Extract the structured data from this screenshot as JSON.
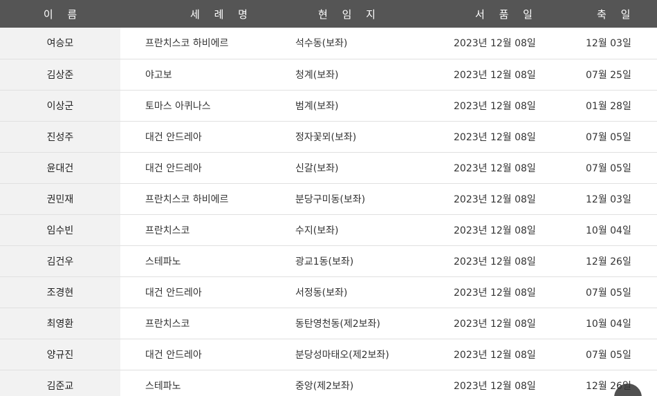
{
  "table": {
    "headers": {
      "name": "이 름",
      "saint_name": "세 례 명",
      "parish": "현 임 지",
      "ordination": "서 품 일",
      "feast_day": "축 일"
    },
    "rows": [
      {
        "name": "여승모",
        "saint_name": "프란치스코 하비에르",
        "parish": "석수동(보좌)",
        "ordination": "2023년 12월 08일",
        "feast_day": "12월 03일"
      },
      {
        "name": "김상준",
        "saint_name": "야고보",
        "parish": "청계(보좌)",
        "ordination": "2023년 12월 08일",
        "feast_day": "07월 25일"
      },
      {
        "name": "이상군",
        "saint_name": "토마스 아퀴나스",
        "parish": "범계(보좌)",
        "ordination": "2023년 12월 08일",
        "feast_day": "01월 28일"
      },
      {
        "name": "진성주",
        "saint_name": "대건 안드레아",
        "parish": "정자꽃뫼(보좌)",
        "ordination": "2023년 12월 08일",
        "feast_day": "07월 05일"
      },
      {
        "name": "윤대건",
        "saint_name": "대건 안드레아",
        "parish": "신갈(보좌)",
        "ordination": "2023년 12월 08일",
        "feast_day": "07월 05일"
      },
      {
        "name": "권민재",
        "saint_name": "프란치스코 하비에르",
        "parish": "분당구미동(보좌)",
        "ordination": "2023년 12월 08일",
        "feast_day": "12월 03일"
      },
      {
        "name": "임수빈",
        "saint_name": "프란치스코",
        "parish": "수지(보좌)",
        "ordination": "2023년 12월 08일",
        "feast_day": "10월 04일"
      },
      {
        "name": "김건우",
        "saint_name": "스테파노",
        "parish": "광교1동(보좌)",
        "ordination": "2023년 12월 08일",
        "feast_day": "12월 26일"
      },
      {
        "name": "조경현",
        "saint_name": "대건 안드레아",
        "parish": "서정동(보좌)",
        "ordination": "2023년 12월 08일",
        "feast_day": "07월 05일"
      },
      {
        "name": "최영환",
        "saint_name": "프란치스코",
        "parish": "동탄영천동(제2보좌)",
        "ordination": "2023년 12월 08일",
        "feast_day": "10월 04일"
      },
      {
        "name": "양규진",
        "saint_name": "대건 안드레아",
        "parish": "분당성마태오(제2보좌)",
        "ordination": "2023년 12월 08일",
        "feast_day": "07월 05일"
      },
      {
        "name": "김준교",
        "saint_name": "스테파노",
        "parish": "중앙(제2보좌)",
        "ordination": "2023년 12월 08일",
        "feast_day": "12월 26일"
      }
    ]
  },
  "colors": {
    "header_bg": "#555555",
    "header_text": "#ffffff",
    "name_column_bg": "#f2f2f2",
    "row_border": "#e0e0e0"
  },
  "icons": {
    "scroll_top": "scroll-to-top-button"
  }
}
